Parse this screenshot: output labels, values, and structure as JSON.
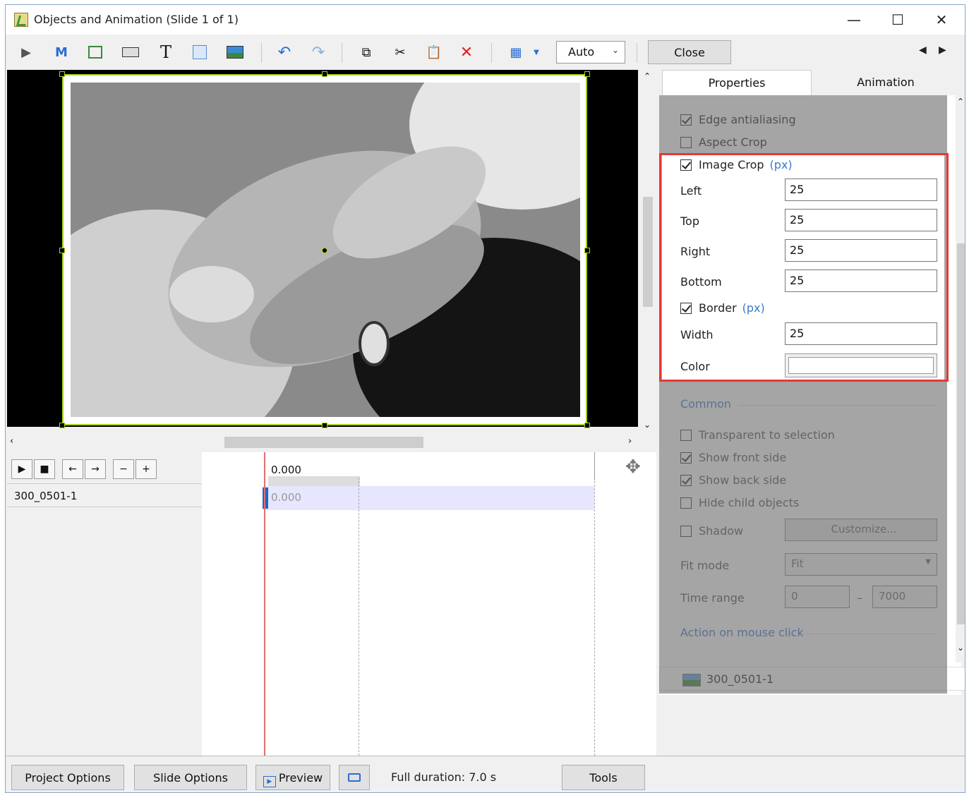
{
  "window": {
    "title": "Objects and Animation (Slide 1 of 1)"
  },
  "toolbar": {
    "auto_select": "Auto",
    "close_label": "Close"
  },
  "timeline": {
    "ruler_value": "0.000",
    "track_value": "0.000",
    "object_name": "300_0501-1"
  },
  "tabs": [
    {
      "label": "Properties"
    },
    {
      "label": "Animation"
    }
  ],
  "properties": {
    "edge_antialiasing": "Edge antialiasing",
    "aspect_crop": "Aspect Crop",
    "image_crop": "Image Crop",
    "px": "(px)",
    "left_label": "Left",
    "left_value": "25",
    "top_label": "Top",
    "top_value": "25",
    "right_label": "Right",
    "right_value": "25",
    "bottom_label": "Bottom",
    "bottom_value": "25",
    "border": "Border",
    "width_label": "Width",
    "width_value": "25",
    "color_label": "Color",
    "common": "Common",
    "transparent": "Transparent to selection",
    "show_front": "Show front side",
    "show_back": "Show back side",
    "hide_child": "Hide child objects",
    "shadow": "Shadow",
    "customize": "Customize...",
    "fit_mode_label": "Fit mode",
    "fit_mode_value": "Fit",
    "time_range_label": "Time range",
    "time_from": "0",
    "time_dash": "–",
    "time_to": "7000",
    "action": "Action on mouse click"
  },
  "object_list": {
    "item": "300_0501-1"
  },
  "bottom": {
    "project_options": "Project Options",
    "slide_options": "Slide Options",
    "preview": "Preview",
    "full_duration": "Full duration: 7.0 s",
    "tools": "Tools"
  }
}
